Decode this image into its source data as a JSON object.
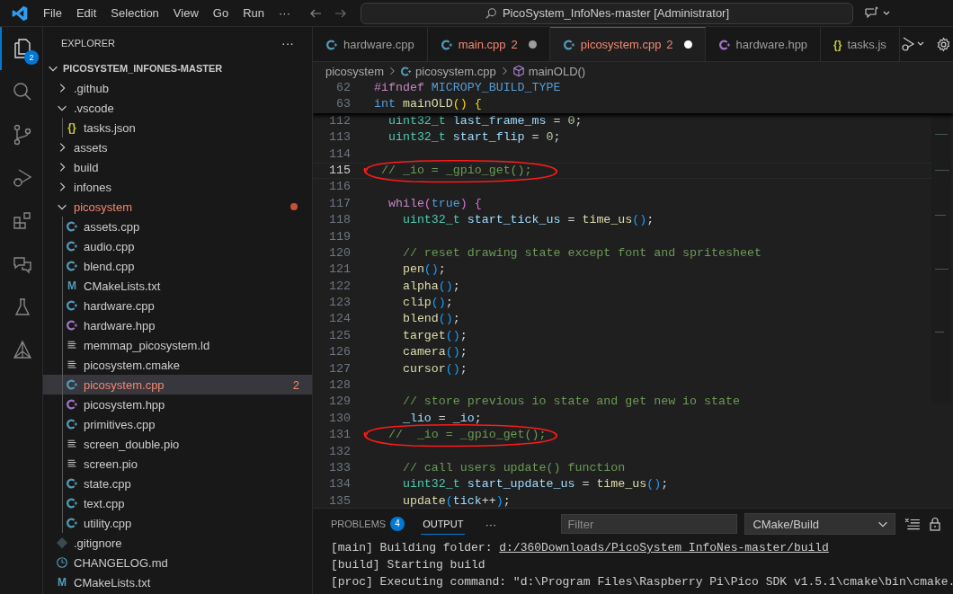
{
  "menu": {
    "items": [
      "File",
      "Edit",
      "Selection",
      "View",
      "Go",
      "Run"
    ],
    "more": "···"
  },
  "command_center": {
    "text": "PicoSystem_InfoNes-master [Administrator]"
  },
  "activity_bar": [
    {
      "kind": "explorer",
      "selected": true,
      "badge": "2"
    },
    {
      "kind": "search",
      "selected": false
    },
    {
      "kind": "source-control",
      "selected": false
    },
    {
      "kind": "run-debug",
      "selected": false
    },
    {
      "kind": "extensions",
      "selected": false
    },
    {
      "kind": "chat",
      "selected": false
    },
    {
      "kind": "testing",
      "selected": false
    },
    {
      "kind": "cmake",
      "selected": false
    }
  ],
  "explorer": {
    "title": "EXPLORER",
    "more": "···",
    "root": {
      "label": "PICOSYSTEM_INFONES-MASTER",
      "expanded": true,
      "children": [
        {
          "label": ".github",
          "kind": "folder",
          "expanded": false,
          "selected": false,
          "error": false
        },
        {
          "label": ".vscode",
          "kind": "folder",
          "expanded": true,
          "selected": false,
          "error": false,
          "children": [
            {
              "label": "tasks.json",
              "kind": "json",
              "glyph": "{}",
              "selected": false,
              "error": false
            }
          ]
        },
        {
          "label": "assets",
          "kind": "folder",
          "expanded": false,
          "selected": false,
          "error": false
        },
        {
          "label": "build",
          "kind": "folder",
          "expanded": false,
          "selected": false,
          "error": false
        },
        {
          "label": "infones",
          "kind": "folder",
          "expanded": false,
          "selected": false,
          "error": false
        },
        {
          "label": "picosystem",
          "kind": "folder",
          "expanded": true,
          "selected": false,
          "error": true,
          "children": [
            {
              "label": "assets.cpp",
              "kind": "cpp",
              "selected": false,
              "error": false
            },
            {
              "label": "audio.cpp",
              "kind": "cpp",
              "selected": false,
              "error": false
            },
            {
              "label": "blend.cpp",
              "kind": "cpp",
              "selected": false,
              "error": false
            },
            {
              "label": "CMakeLists.txt",
              "kind": "cmake",
              "glyph": "M",
              "selected": false,
              "error": false
            },
            {
              "label": "hardware.cpp",
              "kind": "cpp",
              "selected": false,
              "error": false
            },
            {
              "label": "hardware.hpp",
              "kind": "hpp",
              "selected": false,
              "error": false
            },
            {
              "label": "memmap_picosystem.ld",
              "kind": "lines",
              "selected": false,
              "error": false
            },
            {
              "label": "picosystem.cmake",
              "kind": "lines",
              "selected": false,
              "error": false
            },
            {
              "label": "picosystem.cpp",
              "kind": "cpp",
              "selected": true,
              "error": true,
              "badge": "2"
            },
            {
              "label": "picosystem.hpp",
              "kind": "hpp",
              "selected": false,
              "error": false
            },
            {
              "label": "primitives.cpp",
              "kind": "cpp",
              "selected": false,
              "error": false
            },
            {
              "label": "screen_double.pio",
              "kind": "lines",
              "selected": false,
              "error": false
            },
            {
              "label": "screen.pio",
              "kind": "lines",
              "selected": false,
              "error": false
            },
            {
              "label": "state.cpp",
              "kind": "cpp",
              "selected": false,
              "error": false
            },
            {
              "label": "text.cpp",
              "kind": "cpp",
              "selected": false,
              "error": false
            },
            {
              "label": "utility.cpp",
              "kind": "cpp",
              "selected": false,
              "error": false
            }
          ]
        },
        {
          "label": ".gitignore",
          "kind": "git",
          "selected": false,
          "error": false
        },
        {
          "label": "CHANGELOG.md",
          "kind": "changelog",
          "selected": false,
          "error": false
        },
        {
          "label": "CMakeLists.txt",
          "kind": "cmake",
          "glyph": "M",
          "selected": false,
          "error": false
        }
      ]
    }
  },
  "tabs": [
    {
      "label": "hardware.cpp",
      "kind": "cpp",
      "selected": false,
      "error": false,
      "modified": false
    },
    {
      "label": "main.cpp",
      "kind": "cpp",
      "selected": false,
      "error": true,
      "badge": "2",
      "modified": true
    },
    {
      "label": "picosystem.cpp",
      "kind": "cpp",
      "selected": true,
      "error": true,
      "badge": "2",
      "modified": true
    },
    {
      "label": "hardware.hpp",
      "kind": "hpp",
      "selected": false,
      "error": false,
      "modified": false
    },
    {
      "label": "tasks.js",
      "kind": "json",
      "glyph": "{}",
      "selected": false,
      "error": false,
      "modified": false
    }
  ],
  "breadcrumbs": [
    {
      "label": "picosystem",
      "kind": "folder"
    },
    {
      "label": "picosystem.cpp",
      "kind": "cpp"
    },
    {
      "label": "mainOLD()",
      "kind": "function"
    }
  ],
  "editor": {
    "sticky_lines": [
      {
        "number": "62",
        "tokens": [
          {
            "kind": "keyword",
            "t": "#ifndef "
          },
          {
            "kind": "constant",
            "t": "MICROPY_BUILD_TYPE"
          }
        ]
      },
      {
        "number": "63",
        "tokens": [
          {
            "kind": "constant",
            "t": "int "
          },
          {
            "kind": "function",
            "t": "mainOLD"
          },
          {
            "kind": "bracket1",
            "t": "() {"
          }
        ]
      }
    ],
    "lines": [
      {
        "number": "112",
        "current": false,
        "circled": false,
        "tokens": [
          {
            "kind": "type",
            "t": "  uint32_t "
          },
          {
            "kind": "variable",
            "t": "last_frame_ms"
          },
          {
            "kind": "plain",
            "t": " = "
          },
          {
            "kind": "number",
            "t": "0"
          },
          {
            "kind": "plain",
            "t": ";"
          }
        ]
      },
      {
        "number": "113",
        "current": false,
        "circled": false,
        "tokens": [
          {
            "kind": "type",
            "t": "  uint32_t "
          },
          {
            "kind": "variable",
            "t": "start_flip"
          },
          {
            "kind": "plain",
            "t": " = "
          },
          {
            "kind": "number",
            "t": "0"
          },
          {
            "kind": "plain",
            "t": ";"
          }
        ]
      },
      {
        "number": "114",
        "current": false,
        "circled": false
      },
      {
        "number": "115",
        "current": true,
        "circled": true,
        "tokens": [
          {
            "kind": "comment",
            "t": " // _io = _gpio_get();"
          }
        ]
      },
      {
        "number": "116",
        "current": false,
        "circled": false
      },
      {
        "number": "117",
        "current": false,
        "circled": false,
        "tokens": [
          {
            "kind": "keyword",
            "t": "  while"
          },
          {
            "kind": "bracket2",
            "t": "("
          },
          {
            "kind": "constant",
            "t": "true"
          },
          {
            "kind": "bracket2",
            "t": ") {"
          }
        ]
      },
      {
        "number": "118",
        "current": false,
        "circled": false,
        "tokens": [
          {
            "kind": "type",
            "t": "    uint32_t "
          },
          {
            "kind": "variable",
            "t": "start_tick_us"
          },
          {
            "kind": "plain",
            "t": " = "
          },
          {
            "kind": "function",
            "t": "time_us"
          },
          {
            "kind": "bracket3",
            "t": "()"
          },
          {
            "kind": "plain",
            "t": ";"
          }
        ]
      },
      {
        "number": "119",
        "current": false,
        "circled": false
      },
      {
        "number": "120",
        "current": false,
        "circled": false,
        "tokens": [
          {
            "kind": "comment",
            "t": "    // reset drawing state except font and spritesheet"
          }
        ]
      },
      {
        "number": "121",
        "current": false,
        "circled": false,
        "tokens": [
          {
            "kind": "function",
            "t": "    pen"
          },
          {
            "kind": "bracket3",
            "t": "()"
          },
          {
            "kind": "plain",
            "t": ";"
          }
        ]
      },
      {
        "number": "122",
        "current": false,
        "circled": false,
        "tokens": [
          {
            "kind": "function",
            "t": "    alpha"
          },
          {
            "kind": "bracket3",
            "t": "()"
          },
          {
            "kind": "plain",
            "t": ";"
          }
        ]
      },
      {
        "number": "123",
        "current": false,
        "circled": false,
        "tokens": [
          {
            "kind": "function",
            "t": "    clip"
          },
          {
            "kind": "bracket3",
            "t": "()"
          },
          {
            "kind": "plain",
            "t": ";"
          }
        ]
      },
      {
        "number": "124",
        "current": false,
        "circled": false,
        "tokens": [
          {
            "kind": "function",
            "t": "    blend"
          },
          {
            "kind": "bracket3",
            "t": "()"
          },
          {
            "kind": "plain",
            "t": ";"
          }
        ]
      },
      {
        "number": "125",
        "current": false,
        "circled": false,
        "tokens": [
          {
            "kind": "function",
            "t": "    target"
          },
          {
            "kind": "bracket3",
            "t": "()"
          },
          {
            "kind": "plain",
            "t": ";"
          }
        ]
      },
      {
        "number": "126",
        "current": false,
        "circled": false,
        "tokens": [
          {
            "kind": "function",
            "t": "    camera"
          },
          {
            "kind": "bracket3",
            "t": "()"
          },
          {
            "kind": "plain",
            "t": ";"
          }
        ]
      },
      {
        "number": "127",
        "current": false,
        "circled": false,
        "tokens": [
          {
            "kind": "function",
            "t": "    cursor"
          },
          {
            "kind": "bracket3",
            "t": "()"
          },
          {
            "kind": "plain",
            "t": ";"
          }
        ]
      },
      {
        "number": "128",
        "current": false,
        "circled": false
      },
      {
        "number": "129",
        "current": false,
        "circled": false,
        "tokens": [
          {
            "kind": "comment",
            "t": "    // store previous io state and get new io state"
          }
        ]
      },
      {
        "number": "130",
        "current": false,
        "circled": false,
        "tokens": [
          {
            "kind": "variable",
            "t": "    _lio"
          },
          {
            "kind": "plain",
            "t": " = "
          },
          {
            "kind": "variable",
            "t": "_io"
          },
          {
            "kind": "plain",
            "t": ";"
          }
        ]
      },
      {
        "number": "131",
        "current": false,
        "circled": true,
        "tokens": [
          {
            "kind": "comment",
            "t": "  //  _io = _gpio_get();"
          }
        ]
      },
      {
        "number": "132",
        "current": false,
        "circled": false
      },
      {
        "number": "133",
        "current": false,
        "circled": false,
        "tokens": [
          {
            "kind": "comment",
            "t": "    // call users update() function"
          }
        ]
      },
      {
        "number": "134",
        "current": false,
        "circled": false,
        "tokens": [
          {
            "kind": "type",
            "t": "    uint32_t "
          },
          {
            "kind": "variable",
            "t": "start_update_us"
          },
          {
            "kind": "plain",
            "t": " = "
          },
          {
            "kind": "function",
            "t": "time_us"
          },
          {
            "kind": "bracket3",
            "t": "()"
          },
          {
            "kind": "plain",
            "t": ";"
          }
        ]
      },
      {
        "number": "135",
        "current": false,
        "circled": false,
        "tokens": [
          {
            "kind": "function",
            "t": "    update"
          },
          {
            "kind": "bracket3",
            "t": "("
          },
          {
            "kind": "variable",
            "t": "tick"
          },
          {
            "kind": "plain",
            "t": "++"
          },
          {
            "kind": "bracket3",
            "t": ")"
          },
          {
            "kind": "plain",
            "t": ";"
          }
        ]
      }
    ]
  },
  "panel": {
    "tabs": [
      {
        "label": "PROBLEMS",
        "badge": "4",
        "selected": false
      },
      {
        "label": "OUTPUT",
        "selected": true
      }
    ],
    "more": "···",
    "filter": {
      "placeholder": "Filter"
    },
    "channel": "CMake/Build",
    "output": [
      {
        "text": "[main] Building folder: ",
        "link": "d:/360Downloads/PicoSystem_InfoNes-master/build"
      },
      {
        "text": "[build] Starting build"
      },
      {
        "text": "[proc] Executing command: \"d:\\Program Files\\Raspberry Pi\\Pico SDK v1.5.1\\cmake\\bin\\cmake."
      }
    ]
  }
}
